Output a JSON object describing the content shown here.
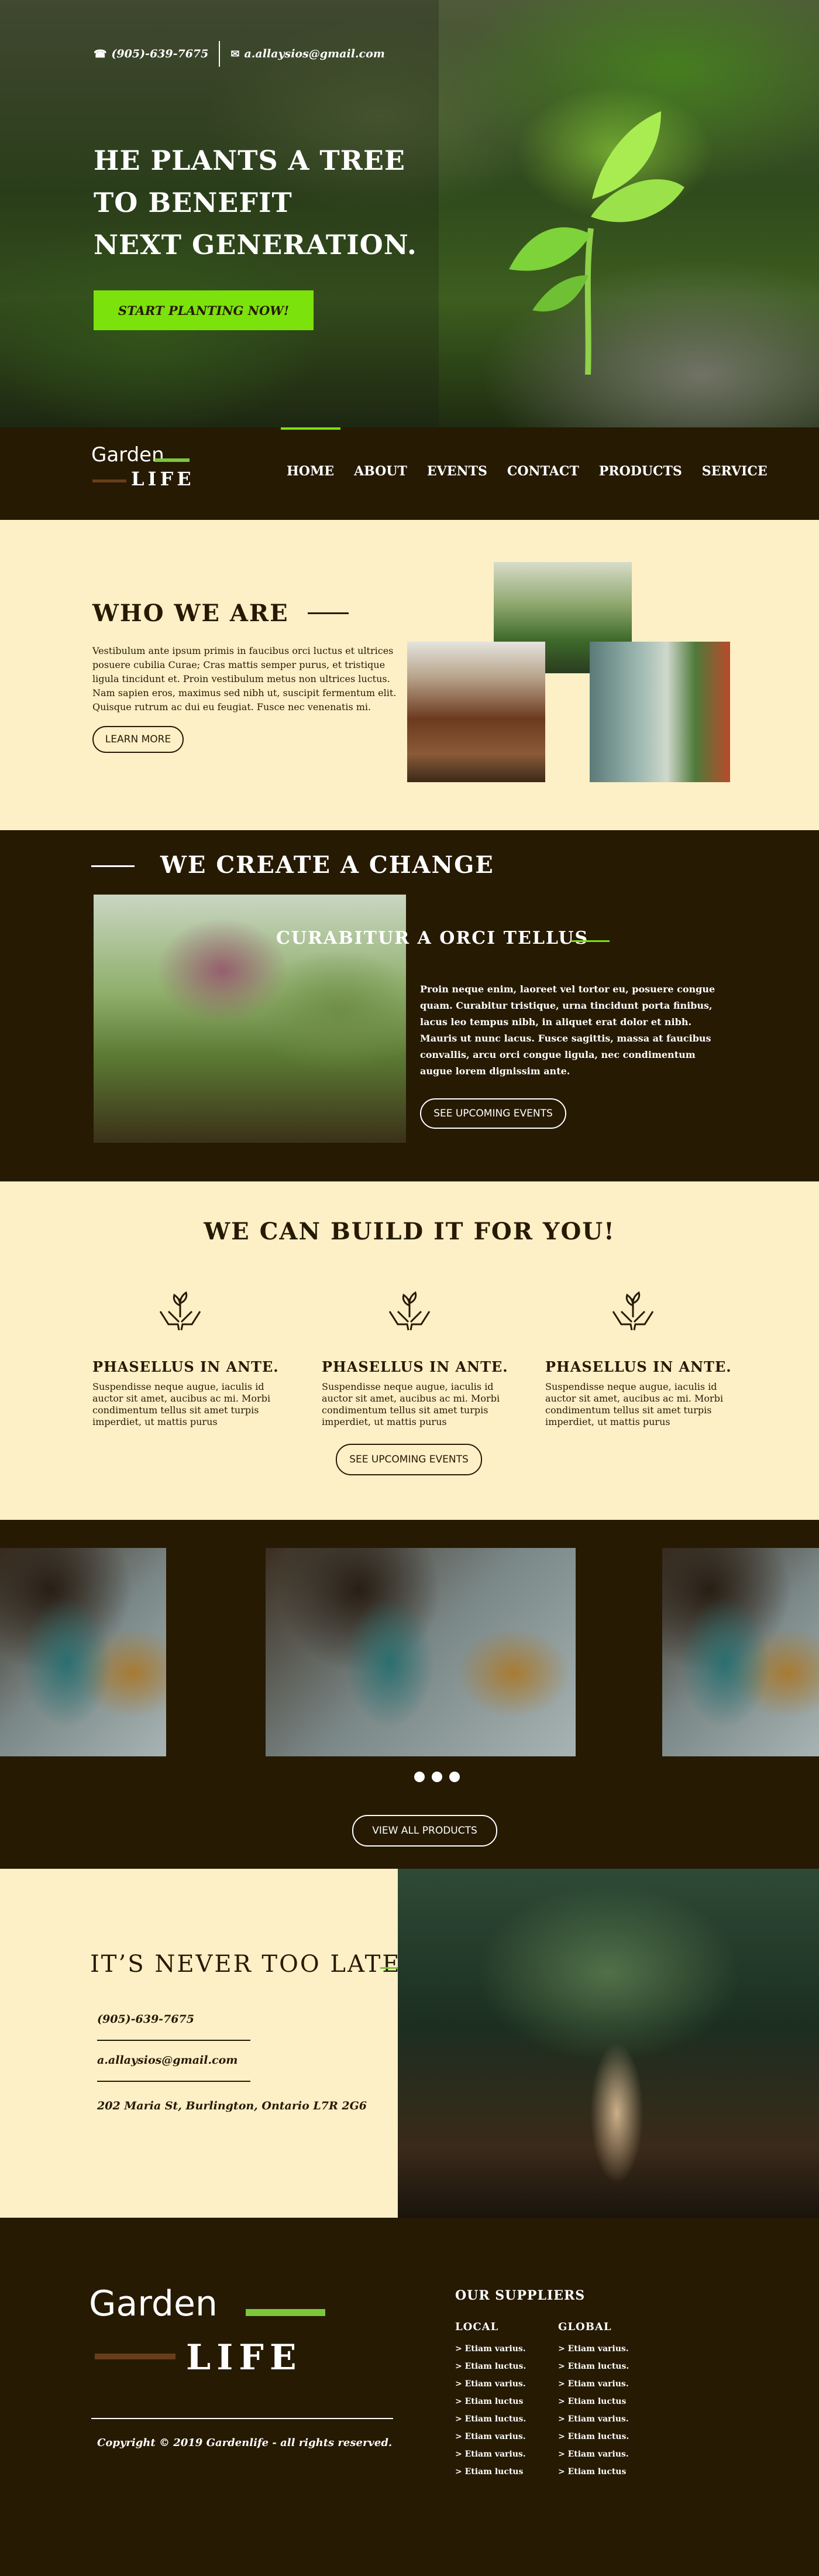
{
  "hero": {
    "phone": "(905)-639-7675",
    "email": "a.allaysios@gmail.com",
    "title_lines": [
      "HE PLANTS A TREE",
      "TO BENEFIT",
      "NEXT GENERATION."
    ],
    "cta_label": "START PLANTING NOW!",
    "icons": [
      "phone-icon",
      "envelope-icon"
    ]
  },
  "nav": {
    "logo_top": "Garden",
    "logo_bottom": "LIFE",
    "items": [
      "HOME",
      "ABOUT",
      "EVENTS",
      "CONTACT",
      "PRODUCTS",
      "SERVICE"
    ],
    "active": "HOME"
  },
  "who": {
    "title": "WHO WE ARE",
    "body": "Vestibulum ante ipsum primis in faucibus orci luctus et ultrices posuere cubilia Curae; Cras mattis semper purus, et tristique ligula tincidunt et. Proin vestibulum metus non ultrices luctus. Nam sapien eros, maximus sed nibh ut, suscipit fermentum elit. Quisque rutrum ac dui eu feugiat. Fusce nec venenatis mi.",
    "button": "LEARN MORE"
  },
  "change": {
    "title": "WE CREATE A CHANGE",
    "subtitle": "CURABITUR A ORCI TELLUS",
    "body": "Proin neque enim, laoreet vel tortor eu, posuere congue quam. Curabitur tristique, urna tincidunt porta finibus, lacus leo tempus nibh, in aliquet erat dolor et nibh. Mauris ut nunc lacus. Fusce sagittis, massa at faucibus convallis, arcu orci congue ligula, nec condimentum augue lorem dignissim ante.",
    "button": "SEE UPCOMING EVENTS"
  },
  "build": {
    "title": "WE CAN BUILD IT FOR YOU!",
    "features": [
      {
        "title": "PHASELLUS IN ANTE.",
        "body": "Suspendisse neque augue, iaculis id auctor sit amet, aucibus ac mi. Morbi condimentum tellus sit amet turpis imperdiet, ut mattis purus",
        "icon": "hands-sprout-icon"
      },
      {
        "title": "PHASELLUS IN ANTE.",
        "body": "Suspendisse neque augue, iaculis id auctor sit amet, aucibus ac mi. Morbi condimentum tellus sit amet turpis imperdiet, ut mattis purus",
        "icon": "hands-sprout-icon"
      },
      {
        "title": "PHASELLUS IN ANTE.",
        "body": "Suspendisse neque augue, iaculis id auctor sit amet, aucibus ac mi. Morbi condimentum tellus sit amet turpis imperdiet, ut mattis purus",
        "icon": "hands-sprout-icon"
      }
    ],
    "button": "SEE UPCOMING EVENTS"
  },
  "products": {
    "button": "VIEW ALL PRODUCTS",
    "slides": 3,
    "dots": 3
  },
  "late": {
    "title": "IT’S NEVER TOO LATE",
    "phone": "(905)-639-7675",
    "email": "a.allaysios@gmail.com",
    "address": "202  Maria St, Burlington, Ontario L7R 2G6"
  },
  "footer": {
    "logo_top": "Garden",
    "logo_bottom": "LIFE",
    "copyright": "Copyright © 2019 Gardenlife - all rights reserved.",
    "suppliers_title": "OUR SUPPLIERS",
    "local": {
      "title": "LOCAL",
      "links": [
        "> Etiam varius.",
        "> Etiam luctus.",
        "> Etiam varius.",
        "> Etiam luctus",
        "> Etiam luctus.",
        "> Etiam varius.",
        "> Etiam varius.",
        "> Etiam luctus"
      ]
    },
    "global": {
      "title": "GLOBAL",
      "links": [
        "> Etiam varius.",
        "> Etiam luctus.",
        "> Etiam varius.",
        "> Etiam luctus",
        "> Etiam varius.",
        "> Etiam luctus.",
        "> Etiam varius.",
        "> Etiam luctus"
      ]
    }
  },
  "colors": {
    "dark_brown": "#261a03",
    "cream": "#fdefc6",
    "accent_green": "#7ce20c",
    "logo_green": "#7cc83a",
    "logo_brown": "#6a3d1a"
  }
}
